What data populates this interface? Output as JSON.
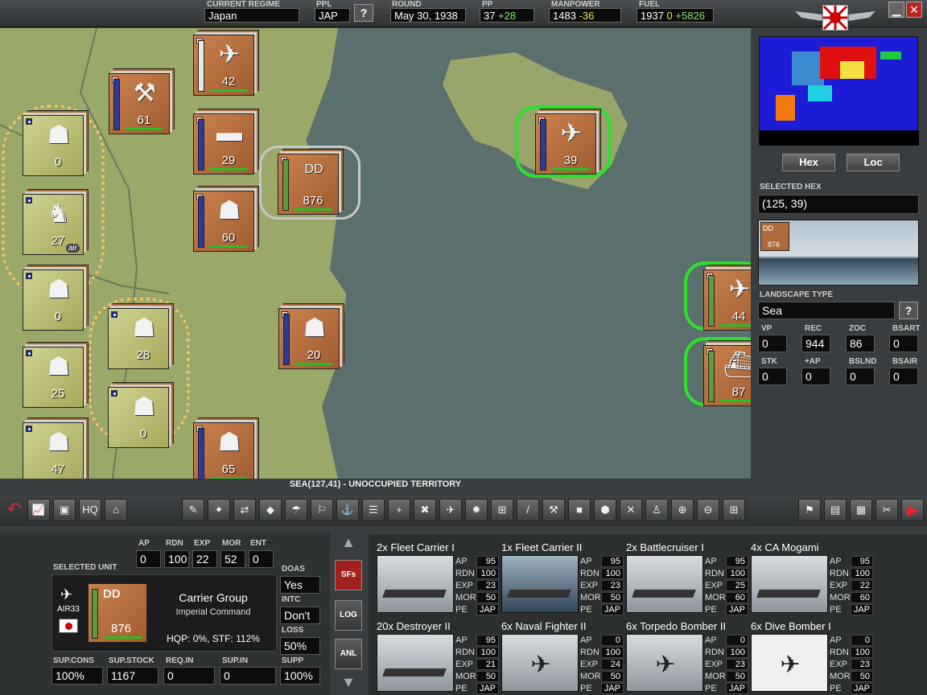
{
  "topbar": {
    "regime_label": "CURRENT REGIME",
    "regime_value": "Japan",
    "ppl_label": "PPL",
    "ppl_value": "JAP",
    "help_q": "?",
    "round_label": "ROUND",
    "round_value": "May 30, 1938",
    "pp_label": "PP",
    "pp_value": "37",
    "pp_delta": "+28",
    "manpower_label": "MANPOWER",
    "manpower_value": "1483",
    "manpower_delta": "-36",
    "fuel_label": "FUEL",
    "fuel_value": "1937",
    "fuel_a": "0",
    "fuel_delta": "+5826",
    "minimize": "▁",
    "close": "✕"
  },
  "map_units": [
    {
      "num": "42",
      "icon": "✈",
      "side": "jp"
    },
    {
      "num": "61",
      "icon": "⚒",
      "side": "jp"
    },
    {
      "num": "29",
      "icon": "▬",
      "side": "jp"
    },
    {
      "num": "876",
      "icon": "DD",
      "side": "jp"
    },
    {
      "num": "39",
      "icon": "✈",
      "side": "jp"
    },
    {
      "num": "60",
      "icon": "☗",
      "side": "jp"
    },
    {
      "num": "0",
      "icon": "☗",
      "side": "cn"
    },
    {
      "num": "27",
      "icon": "♞",
      "side": "cn",
      "tag": "air"
    },
    {
      "num": "0",
      "icon": "☗",
      "side": "cn"
    },
    {
      "num": "28",
      "icon": "☗",
      "side": "cn"
    },
    {
      "num": "20",
      "icon": "☗",
      "side": "jp"
    },
    {
      "num": "25",
      "icon": "☗",
      "side": "cn"
    },
    {
      "num": "0",
      "icon": "☗",
      "side": "cn"
    },
    {
      "num": "47",
      "icon": "☗",
      "side": "cn"
    },
    {
      "num": "65",
      "icon": "☗",
      "side": "jp"
    },
    {
      "num": "44",
      "icon": "✈",
      "side": "jp"
    },
    {
      "num": "87",
      "icon": "⛴",
      "side": "jp"
    }
  ],
  "status_text": "SEA(127,41) - UNOCCUPIED TERRITORY",
  "right": {
    "hex_btn": "Hex",
    "loc_btn": "Loc",
    "selected_hex_label": "SELECTED HEX",
    "selected_hex_value": "(125, 39)",
    "thumb_unit": "DD",
    "thumb_num": "876",
    "landscape_label": "LANDSCAPE TYPE",
    "landscape_value": "Sea",
    "landscape_q": "?",
    "labels1": [
      "VP",
      "REC",
      "ZOC",
      "BSART"
    ],
    "values1": [
      "0",
      "944",
      "86",
      "0"
    ],
    "labels2": [
      "STK",
      "+AP",
      "BSLND",
      "BSAIR"
    ],
    "values2": [
      "0",
      "0",
      "0",
      "0"
    ]
  },
  "unit_panel": {
    "ap_label": "AP",
    "ap": "0",
    "rdn_label": "RDN",
    "rdn": "100",
    "exp_label": "EXP",
    "exp": "22",
    "mor_label": "MOR",
    "mor": "52",
    "ent_label": "ENT",
    "ent": "0",
    "selected_label": "SELECTED UNIT",
    "hq_code": "AIR33",
    "counter_type": "DD",
    "counter_num": "876",
    "unit_name": "Carrier Group",
    "unit_sub": "Imperial Command",
    "hqp_line": "HQP: 0%, STF: 112%",
    "doas_label": "DOAS",
    "doas": "Yes",
    "intc_label": "INTC",
    "intc": "Don't",
    "loss_label": "LOSS",
    "loss": "50%",
    "supcons_label": "SUP.CONS",
    "supcons": "100%",
    "supstock_label": "SUP.STOCK",
    "supstock": "1167",
    "reqin_label": "REQ.IN",
    "reqin": "0",
    "supin_label": "SUP.IN",
    "supin": "0",
    "supp_label": "SUPP",
    "supp": "100%"
  },
  "side_buttons": [
    "SFs",
    "LOG",
    "ANL"
  ],
  "ships": [
    {
      "name": "2x Fleet Carrier I",
      "ap": "95",
      "rdn": "100",
      "exp": "23",
      "mor": "50",
      "pe": "JAP",
      "kind": "ship"
    },
    {
      "name": "1x Fleet Carrier II",
      "ap": "95",
      "rdn": "100",
      "exp": "23",
      "mor": "50",
      "pe": "JAP",
      "kind": "ship"
    },
    {
      "name": "2x Battlecruiser I",
      "ap": "95",
      "rdn": "100",
      "exp": "25",
      "mor": "60",
      "pe": "JAP",
      "kind": "ship"
    },
    {
      "name": "4x CA Mogami",
      "ap": "95",
      "rdn": "100",
      "exp": "22",
      "mor": "60",
      "pe": "JAP",
      "kind": "ship"
    },
    {
      "name": "20x Destroyer II",
      "ap": "95",
      "rdn": "100",
      "exp": "21",
      "mor": "50",
      "pe": "JAP",
      "kind": "ship"
    },
    {
      "name": "6x Naval Fighter II",
      "ap": "0",
      "rdn": "100",
      "exp": "24",
      "mor": "50",
      "pe": "JAP",
      "kind": "plane"
    },
    {
      "name": "6x Torpedo Bomber II",
      "ap": "0",
      "rdn": "100",
      "exp": "23",
      "mor": "50",
      "pe": "JAP",
      "kind": "plane"
    },
    {
      "name": "6x Dive Bomber I",
      "ap": "0",
      "rdn": "100",
      "exp": "23",
      "mor": "50",
      "pe": "JAP",
      "kind": "plane"
    }
  ],
  "stat_labels": [
    "AP",
    "RDN",
    "EXP",
    "MOR",
    "PE"
  ],
  "colors": {
    "japan": "#a25b30",
    "china": "#a7a85c",
    "sea": "#5a6f6a",
    "land": "#9aa86a",
    "hp": "#24c224"
  }
}
